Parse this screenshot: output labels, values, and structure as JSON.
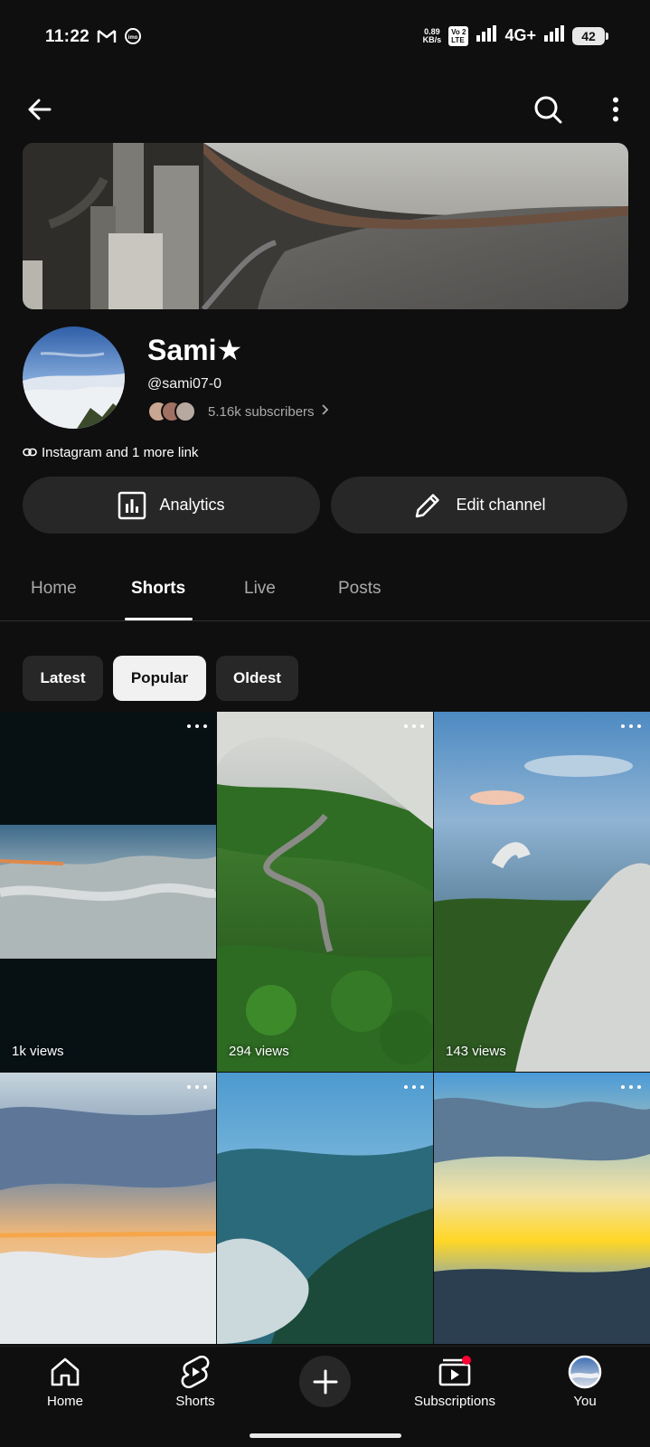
{
  "status_bar": {
    "time": "11:22",
    "speed_value": "0.89",
    "speed_unit": "KB/s",
    "volte_top": "Vo",
    "volte_sub": "2",
    "volte_bottom": "LTE",
    "network": "4G+",
    "battery": "42"
  },
  "channel": {
    "name": "Sami★",
    "handle": "@sami07-0",
    "subscribers": "5.16k subscribers",
    "links": "Instagram and 1 more link"
  },
  "actions": {
    "analytics_label": "Analytics",
    "edit_label": "Edit channel"
  },
  "tabs": [
    "Home",
    "Shorts",
    "Live",
    "Posts"
  ],
  "active_tab": "Shorts",
  "chips": [
    "Latest",
    "Popular",
    "Oldest"
  ],
  "active_chip": "Popular",
  "shorts": [
    {
      "views": "1k views"
    },
    {
      "views": "294 views"
    },
    {
      "views": "143 views"
    },
    {
      "views": ""
    },
    {
      "views": ""
    },
    {
      "views": ""
    }
  ],
  "bottom_nav": {
    "home": "Home",
    "shorts": "Shorts",
    "create": "",
    "subscriptions": "Subscriptions",
    "you": "You"
  },
  "colors": {
    "background": "#0f0f0f",
    "surface": "#272727",
    "notification_dot": "#ff0033"
  }
}
